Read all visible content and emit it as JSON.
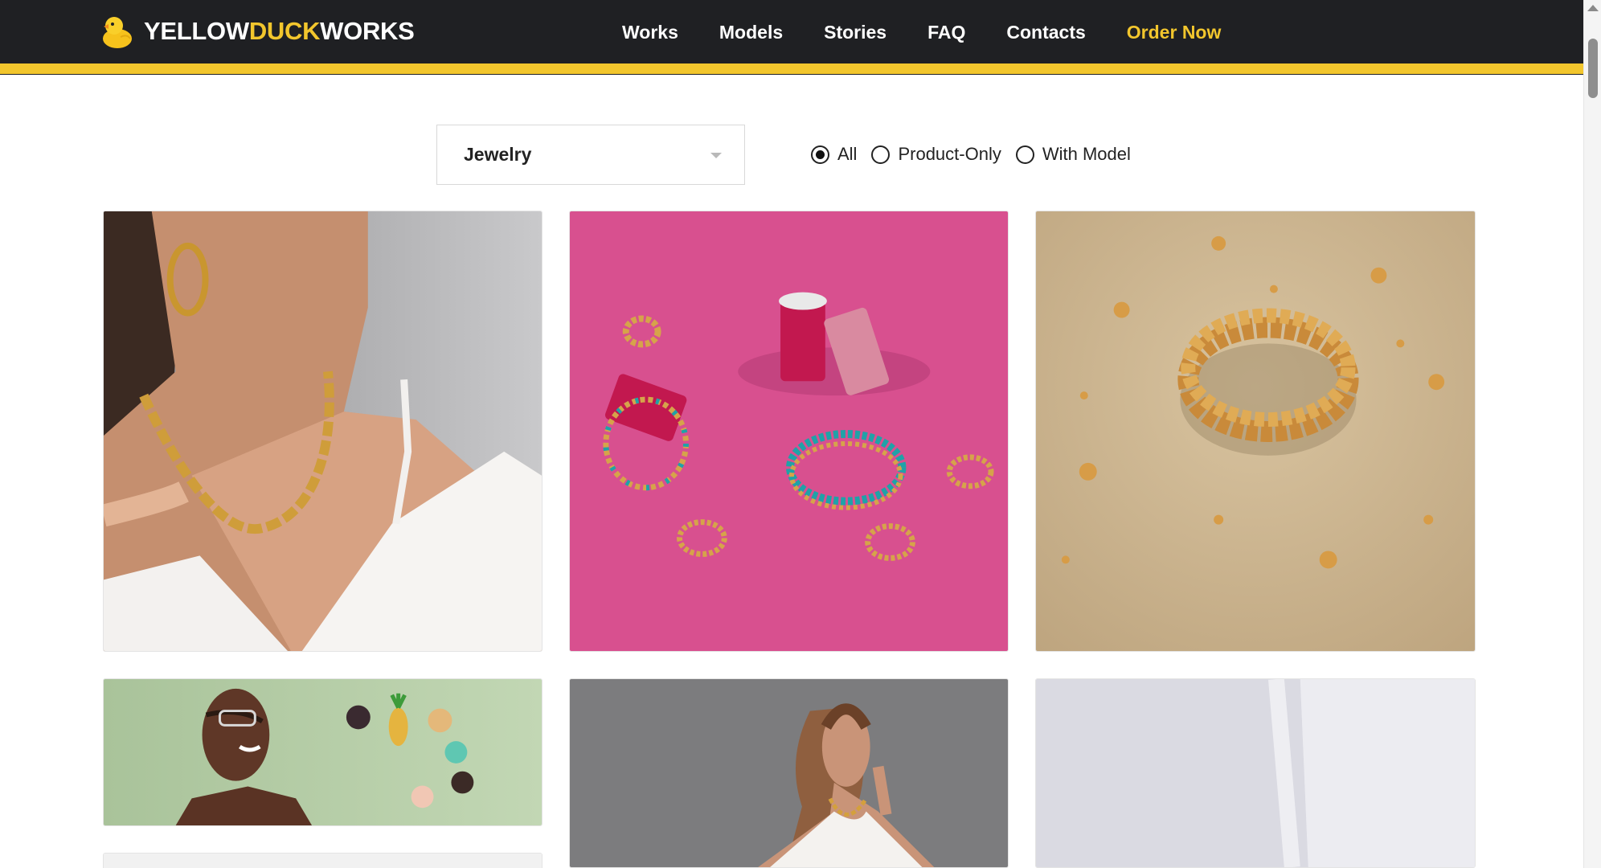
{
  "brand": {
    "name_part1": "YELLOW",
    "name_part2": "DUCK",
    "name_part3": "WORKS",
    "logo_icon": "rubber-duck-icon",
    "colors": {
      "header_bg": "#1f2023",
      "accent": "#f2c62d"
    }
  },
  "nav": {
    "items": [
      {
        "label": "Works"
      },
      {
        "label": "Models"
      },
      {
        "label": "Stories"
      },
      {
        "label": "FAQ"
      },
      {
        "label": "Contacts"
      }
    ],
    "cta_label": "Order Now"
  },
  "filters": {
    "category": {
      "selected": "Jewelry"
    },
    "view_options": [
      {
        "label": "All",
        "checked": true
      },
      {
        "label": "Product-Only",
        "checked": false
      },
      {
        "label": "With Model",
        "checked": false
      }
    ]
  },
  "gallery": {
    "items": [
      {
        "subject": "model-gold-chain-necklace-hoop-earrings"
      },
      {
        "subject": "beaded-bracelets-thread-spools-pink"
      },
      {
        "subject": "gold-bead-bracelet-beige"
      },
      {
        "subject": "model-smiling-flower-brooches-green"
      },
      {
        "subject": "model-gold-necklace-gray"
      },
      {
        "subject": "light-gray-studio-corner"
      }
    ]
  }
}
